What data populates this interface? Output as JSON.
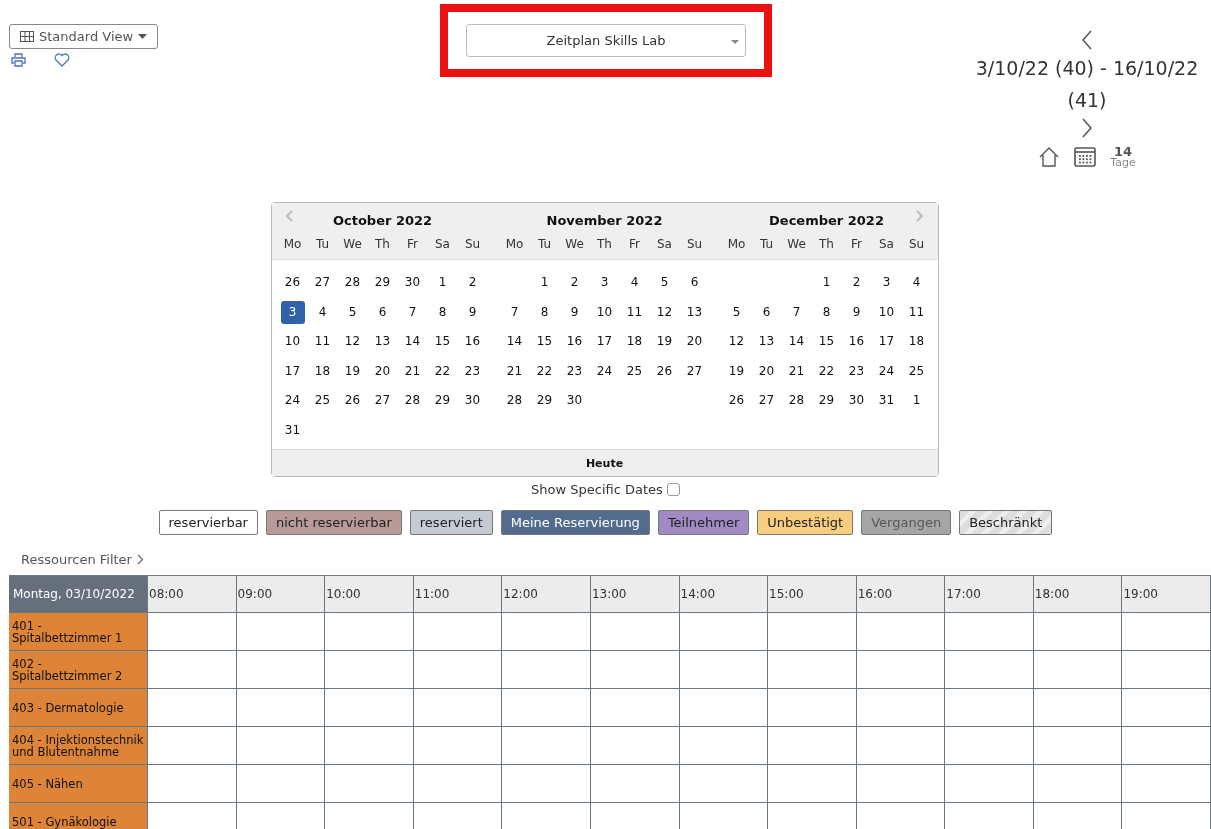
{
  "view_button": {
    "label": "Standard View"
  },
  "schedule_select": {
    "value": "Zeitplan Skills Lab",
    "highlighted": true
  },
  "range_nav": {
    "range": "3/10/22 (40) - 16/10/22 (41)",
    "days_count": "14",
    "days_unit": "Tage"
  },
  "calendar": {
    "months": [
      {
        "title": "October 2022",
        "weekdays": [
          "Mo",
          "Tu",
          "We",
          "Th",
          "Fr",
          "Sa",
          "Su"
        ],
        "weeks": [
          [
            {
              "kind": "day",
              "t": "26",
              "selected": false
            },
            {
              "kind": "day",
              "t": "27",
              "selected": false
            },
            {
              "kind": "day",
              "t": "28",
              "selected": false
            },
            {
              "kind": "day",
              "t": "29",
              "selected": false
            },
            {
              "kind": "day",
              "t": "30",
              "selected": false
            },
            {
              "kind": "day",
              "t": "1",
              "selected": false
            },
            {
              "kind": "day",
              "t": "2",
              "selected": false
            }
          ],
          [
            {
              "kind": "day",
              "t": "3",
              "selected": true
            },
            {
              "kind": "day",
              "t": "4",
              "selected": false
            },
            {
              "kind": "day",
              "t": "5",
              "selected": false
            },
            {
              "kind": "day",
              "t": "6",
              "selected": false
            },
            {
              "kind": "day",
              "t": "7",
              "selected": false
            },
            {
              "kind": "day",
              "t": "8",
              "selected": false
            },
            {
              "kind": "day",
              "t": "9",
              "selected": false
            }
          ],
          [
            {
              "kind": "day",
              "t": "10",
              "selected": false
            },
            {
              "kind": "day",
              "t": "11",
              "selected": false
            },
            {
              "kind": "day",
              "t": "12",
              "selected": false
            },
            {
              "kind": "day",
              "t": "13",
              "selected": false
            },
            {
              "kind": "day",
              "t": "14",
              "selected": false
            },
            {
              "kind": "day",
              "t": "15",
              "selected": false
            },
            {
              "kind": "day",
              "t": "16",
              "selected": false
            }
          ],
          [
            {
              "kind": "day",
              "t": "17",
              "selected": false
            },
            {
              "kind": "day",
              "t": "18",
              "selected": false
            },
            {
              "kind": "day",
              "t": "19",
              "selected": false
            },
            {
              "kind": "day",
              "t": "20",
              "selected": false
            },
            {
              "kind": "day",
              "t": "21",
              "selected": false
            },
            {
              "kind": "day",
              "t": "22",
              "selected": false
            },
            {
              "kind": "day",
              "t": "23",
              "selected": false
            }
          ],
          [
            {
              "kind": "day",
              "t": "24",
              "selected": false
            },
            {
              "kind": "day",
              "t": "25",
              "selected": false
            },
            {
              "kind": "day",
              "t": "26",
              "selected": false
            },
            {
              "kind": "day",
              "t": "27",
              "selected": false
            },
            {
              "kind": "day",
              "t": "28",
              "selected": false
            },
            {
              "kind": "day",
              "t": "29",
              "selected": false
            },
            {
              "kind": "day",
              "t": "30",
              "selected": false
            }
          ],
          [
            {
              "kind": "day",
              "t": "31",
              "selected": false
            }
          ]
        ]
      },
      {
        "title": "November 2022",
        "weekdays": [
          "Mo",
          "Tu",
          "We",
          "Th",
          "Fr",
          "Sa",
          "Su"
        ],
        "weeks": [
          [
            {
              "kind": "blank"
            },
            {
              "kind": "day",
              "t": "1",
              "selected": false
            },
            {
              "kind": "day",
              "t": "2",
              "selected": false
            },
            {
              "kind": "day",
              "t": "3",
              "selected": false
            },
            {
              "kind": "day",
              "t": "4",
              "selected": false
            },
            {
              "kind": "day",
              "t": "5",
              "selected": false
            },
            {
              "kind": "day",
              "t": "6",
              "selected": false
            }
          ],
          [
            {
              "kind": "day",
              "t": "7",
              "selected": false
            },
            {
              "kind": "day",
              "t": "8",
              "selected": false
            },
            {
              "kind": "day",
              "t": "9",
              "selected": false
            },
            {
              "kind": "day",
              "t": "10",
              "selected": false
            },
            {
              "kind": "day",
              "t": "11",
              "selected": false
            },
            {
              "kind": "day",
              "t": "12",
              "selected": false
            },
            {
              "kind": "day",
              "t": "13",
              "selected": false
            }
          ],
          [
            {
              "kind": "day",
              "t": "14",
              "selected": false
            },
            {
              "kind": "day",
              "t": "15",
              "selected": false
            },
            {
              "kind": "day",
              "t": "16",
              "selected": false
            },
            {
              "kind": "day",
              "t": "17",
              "selected": false
            },
            {
              "kind": "day",
              "t": "18",
              "selected": false
            },
            {
              "kind": "day",
              "t": "19",
              "selected": false
            },
            {
              "kind": "day",
              "t": "20",
              "selected": false
            }
          ],
          [
            {
              "kind": "day",
              "t": "21",
              "selected": false
            },
            {
              "kind": "day",
              "t": "22",
              "selected": false
            },
            {
              "kind": "day",
              "t": "23",
              "selected": false
            },
            {
              "kind": "day",
              "t": "24",
              "selected": false
            },
            {
              "kind": "day",
              "t": "25",
              "selected": false
            },
            {
              "kind": "day",
              "t": "26",
              "selected": false
            },
            {
              "kind": "day",
              "t": "27",
              "selected": false
            }
          ],
          [
            {
              "kind": "day",
              "t": "28",
              "selected": false
            },
            {
              "kind": "day",
              "t": "29",
              "selected": false
            },
            {
              "kind": "day",
              "t": "30",
              "selected": false
            }
          ]
        ]
      },
      {
        "title": "December 2022",
        "weekdays": [
          "Mo",
          "Tu",
          "We",
          "Th",
          "Fr",
          "Sa",
          "Su"
        ],
        "weeks": [
          [
            {
              "kind": "blank"
            },
            {
              "kind": "blank"
            },
            {
              "kind": "blank"
            },
            {
              "kind": "day",
              "t": "1",
              "selected": false
            },
            {
              "kind": "day",
              "t": "2",
              "selected": false
            },
            {
              "kind": "day",
              "t": "3",
              "selected": false
            },
            {
              "kind": "day",
              "t": "4",
              "selected": false
            }
          ],
          [
            {
              "kind": "day",
              "t": "5",
              "selected": false
            },
            {
              "kind": "day",
              "t": "6",
              "selected": false
            },
            {
              "kind": "day",
              "t": "7",
              "selected": false
            },
            {
              "kind": "day",
              "t": "8",
              "selected": false
            },
            {
              "kind": "day",
              "t": "9",
              "selected": false
            },
            {
              "kind": "day",
              "t": "10",
              "selected": false
            },
            {
              "kind": "day",
              "t": "11",
              "selected": false
            }
          ],
          [
            {
              "kind": "day",
              "t": "12",
              "selected": false
            },
            {
              "kind": "day",
              "t": "13",
              "selected": false
            },
            {
              "kind": "day",
              "t": "14",
              "selected": false
            },
            {
              "kind": "day",
              "t": "15",
              "selected": false
            },
            {
              "kind": "day",
              "t": "16",
              "selected": false
            },
            {
              "kind": "day",
              "t": "17",
              "selected": false
            },
            {
              "kind": "day",
              "t": "18",
              "selected": false
            }
          ],
          [
            {
              "kind": "day",
              "t": "19",
              "selected": false
            },
            {
              "kind": "day",
              "t": "20",
              "selected": false
            },
            {
              "kind": "day",
              "t": "21",
              "selected": false
            },
            {
              "kind": "day",
              "t": "22",
              "selected": false
            },
            {
              "kind": "day",
              "t": "23",
              "selected": false
            },
            {
              "kind": "day",
              "t": "24",
              "selected": false
            },
            {
              "kind": "day",
              "t": "25",
              "selected": false
            }
          ],
          [
            {
              "kind": "day",
              "t": "26",
              "selected": false
            },
            {
              "kind": "day",
              "t": "27",
              "selected": false
            },
            {
              "kind": "day",
              "t": "28",
              "selected": false
            },
            {
              "kind": "day",
              "t": "29",
              "selected": false
            },
            {
              "kind": "day",
              "t": "30",
              "selected": false
            },
            {
              "kind": "day",
              "t": "31",
              "selected": false
            },
            {
              "kind": "day",
              "t": "1",
              "selected": false
            }
          ]
        ]
      }
    ],
    "today_button": "Heute"
  },
  "specific_dates": {
    "label": "Show Specific Dates",
    "checked": false
  },
  "legend": [
    {
      "label": "reservierbar",
      "color": "#ffffff",
      "striped": false
    },
    {
      "label": "nicht reservierbar",
      "color": "#b89b97",
      "striped": false
    },
    {
      "label": "reserviert",
      "color": "#c4cbd2",
      "striped": false
    },
    {
      "label": "Meine Reservierung",
      "color": "#536b8c",
      "striped": false
    },
    {
      "label": "Teilnehmer",
      "color": "#a28bc4",
      "striped": false
    },
    {
      "label": "Unbestätigt",
      "color": "#f7cd7f",
      "striped": false
    },
    {
      "label": "Vergangen",
      "color": "#a6a6a6",
      "striped": false
    },
    {
      "label": "Beschränkt",
      "color": "#dddddd",
      "striped": true
    }
  ],
  "resource_filter": "Ressourcen Filter",
  "table": {
    "corner": "Montag, 03/10/2022",
    "columns": [
      "08:00",
      "09:00",
      "10:00",
      "11:00",
      "12:00",
      "13:00",
      "14:00",
      "15:00",
      "16:00",
      "17:00",
      "18:00",
      "19:00"
    ],
    "rows": [
      "401 - Spitalbettzimmer 1",
      "402 - Spitalbettzimmer 2",
      "403 - Dermatologie",
      "404 - Injektionstechnik und Blutentnahme",
      "405 - Nähen",
      "501 - Gynäkologie"
    ]
  }
}
